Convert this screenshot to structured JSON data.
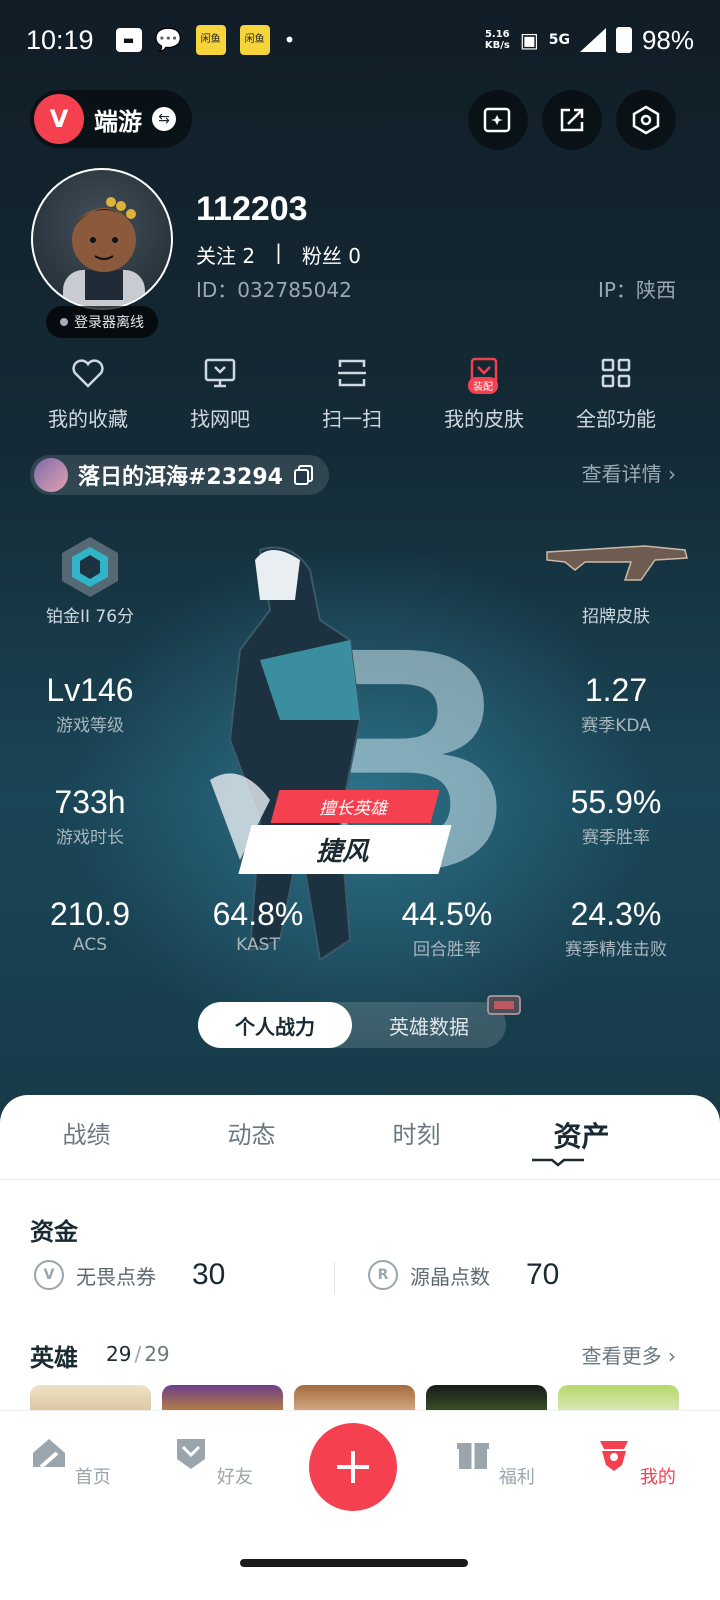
{
  "status_bar": {
    "time": "10:19",
    "net_speed": "5.16\nKB/s",
    "network": "5G",
    "battery": "98%",
    "app_badge": "闲鱼"
  },
  "header": {
    "app_name": "端游",
    "app_logo_letter": "V"
  },
  "profile": {
    "username": "112203",
    "follow_label": "关注",
    "follow_count": "2",
    "separator": "|",
    "fans_label": "粉丝",
    "fans_count": "0",
    "id": "ID：032785042",
    "ip": "IP：陕西",
    "status": "登录器离线"
  },
  "quick_actions": [
    {
      "label": "我的收藏",
      "icon": "heart-icon"
    },
    {
      "label": "找网吧",
      "icon": "monitor-icon"
    },
    {
      "label": "扫一扫",
      "icon": "scan-icon"
    },
    {
      "label": "我的皮肤",
      "icon": "skin-icon",
      "tag": "装配"
    },
    {
      "label": "全部功能",
      "icon": "grid-icon"
    }
  ],
  "game_account": {
    "riot_id": "落日的洱海#23294",
    "details": "查看详情"
  },
  "stats": {
    "rank": "铂金II 76分",
    "skin": "招牌皮肤",
    "level_value": "Lv146",
    "level_label": "游戏等级",
    "kda_value": "1.27",
    "kda_label": "赛季KDA",
    "hours_value": "733h",
    "hours_label": "游戏时长",
    "winrate_value": "55.9%",
    "winrate_label": "赛季胜率",
    "acs_value": "210.9",
    "acs_label": "ACS",
    "kast_value": "64.8%",
    "kast_label": "KAST",
    "round_value": "44.5%",
    "round_label": "回合胜率",
    "hs_value": "24.3%",
    "hs_label": "赛季精准击败",
    "grade": "B",
    "best_hero_tag": "擅长英雄",
    "best_hero_name": "捷风"
  },
  "toggle": {
    "personal": "个人战力",
    "heroes": "英雄数据"
  },
  "tabs": [
    "战绩",
    "动态",
    "时刻",
    "资产"
  ],
  "assets": {
    "funds_title": "资金",
    "vp_label": "无畏点券",
    "vp_value": "30",
    "rp_label": "源晶点数",
    "rp_value": "70",
    "heroes_title": "英雄",
    "heroes_owned": "29",
    "heroes_slash": "/",
    "heroes_total": "29",
    "more": "查看更多"
  },
  "bottom_nav": [
    {
      "label": "首页",
      "icon": "home-icon"
    },
    {
      "label": "好友",
      "icon": "friends-icon"
    },
    {
      "label": "福利",
      "icon": "gift-icon"
    },
    {
      "label": "我的",
      "icon": "profile-icon"
    }
  ],
  "colors": {
    "accent": "#f5404f",
    "bg_dark": "#142b37",
    "text_dark": "#1a2a33"
  }
}
